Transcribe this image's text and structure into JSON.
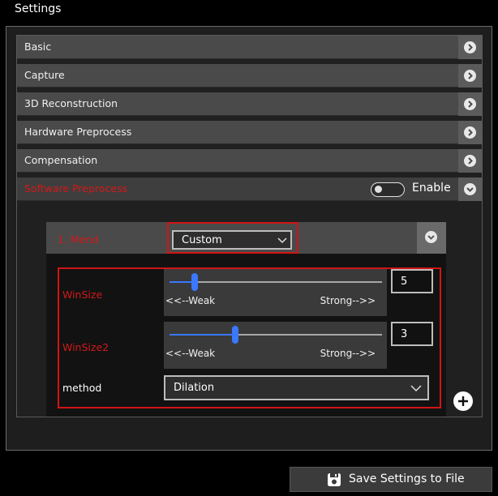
{
  "window": {
    "title": "Settings"
  },
  "sections": [
    {
      "label": "Basic"
    },
    {
      "label": "Capture"
    },
    {
      "label": "3D Reconstruction"
    },
    {
      "label": "Hardware Preprocess"
    },
    {
      "label": "Compensation"
    },
    {
      "label": "Software Preprocess"
    }
  ],
  "software_preprocess": {
    "enable_label": "Enable",
    "enabled": false,
    "mend": {
      "label": "1. Mend",
      "mode": "Custom",
      "params": [
        {
          "label": "WinSize",
          "weak": "<<--Weak",
          "strong": "Strong-->>",
          "value": "5",
          "slider_fraction": 0.12
        },
        {
          "label": "WinSize2",
          "weak": "<<--Weak",
          "strong": "Strong-->>",
          "value": "3",
          "slider_fraction": 0.31
        }
      ],
      "method_label": "method",
      "method_value": "Dilation"
    }
  },
  "save_button": {
    "label": "Save Settings to File"
  },
  "colors": {
    "accent": "#3a78ff",
    "highlight_red": "#d41818"
  }
}
